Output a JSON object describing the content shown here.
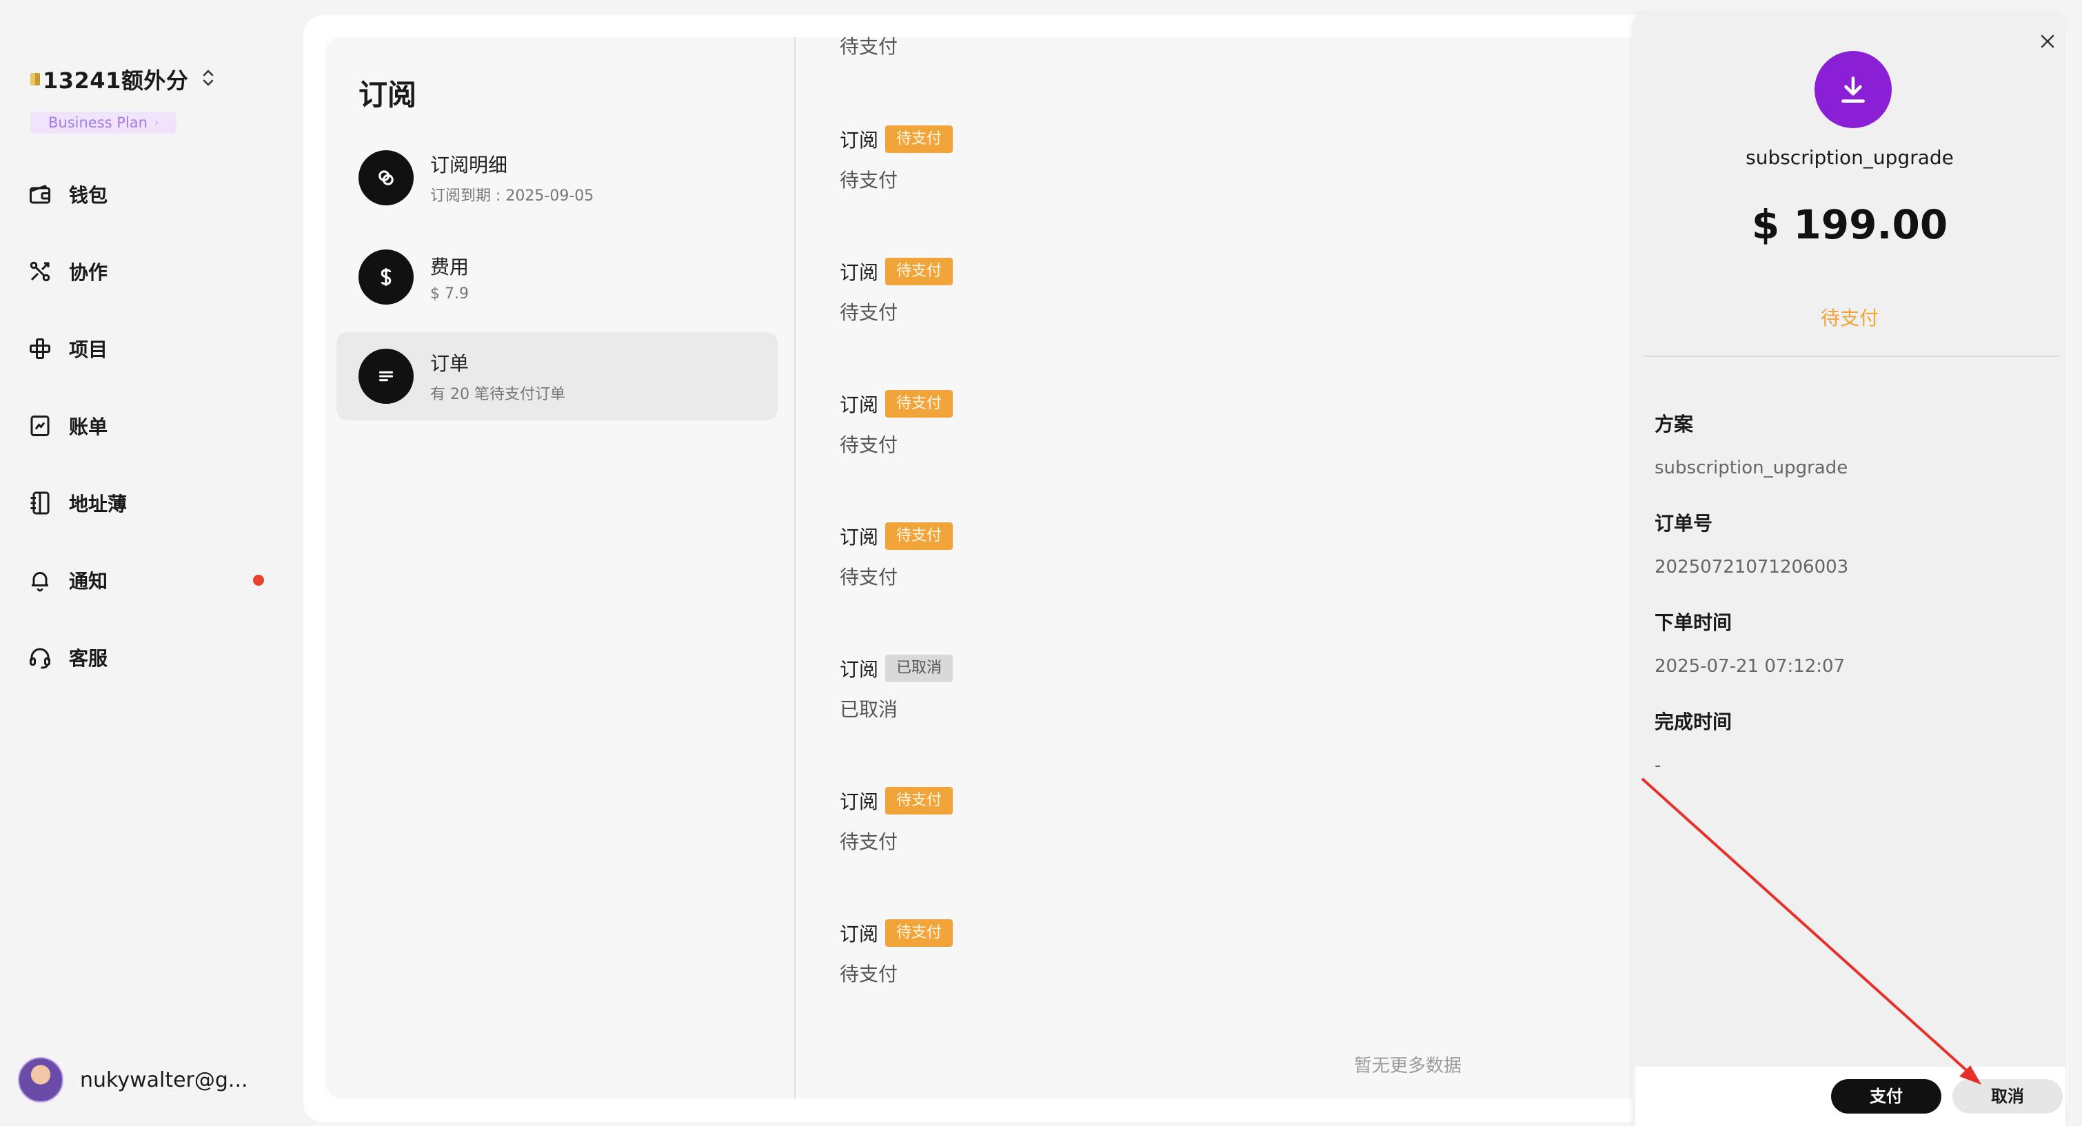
{
  "workspace": {
    "name": "13241额外分",
    "plan_badge": "Business Plan",
    "switch_icon": "chevron-up-down-icon"
  },
  "nav": [
    {
      "label": "钱包",
      "icon": "wallet-icon"
    },
    {
      "label": "协作",
      "icon": "collaborate-icon"
    },
    {
      "label": "项目",
      "icon": "project-icon"
    },
    {
      "label": "账单",
      "icon": "bill-icon"
    },
    {
      "label": "地址薄",
      "icon": "address-book-icon"
    },
    {
      "label": "通知",
      "icon": "bell-icon",
      "has_unread_dot": true
    },
    {
      "label": "客服",
      "icon": "headset-icon"
    }
  ],
  "user": {
    "email": "nukywalter@g..."
  },
  "subscription": {
    "title": "订阅",
    "menu": [
      {
        "title": "订阅明细",
        "subtitle": "订阅到期 : 2025-09-05",
        "icon": "link-icon"
      },
      {
        "title": "费用",
        "subtitle": "$ 7.9",
        "icon": "dollar-icon"
      },
      {
        "title": "订单",
        "subtitle": "有 20 笔待支付订单",
        "icon": "list-icon",
        "active": true
      }
    ]
  },
  "orders": {
    "top_partial_status": "待支付",
    "items": [
      {
        "title": "订阅",
        "tag": "待支付",
        "status": "待支付",
        "kind": "pending"
      },
      {
        "title": "订阅",
        "tag": "待支付",
        "status": "待支付",
        "kind": "pending"
      },
      {
        "title": "订阅",
        "tag": "待支付",
        "status": "待支付",
        "kind": "pending"
      },
      {
        "title": "订阅",
        "tag": "待支付",
        "status": "待支付",
        "kind": "pending"
      },
      {
        "title": "订阅",
        "tag": "已取消",
        "status": "已取消",
        "kind": "cancel"
      },
      {
        "title": "订阅",
        "tag": "待支付",
        "status": "待支付",
        "kind": "pending"
      },
      {
        "title": "订阅",
        "tag": "待支付",
        "status": "待支付",
        "kind": "pending"
      }
    ],
    "no_more": "暂无更多数据"
  },
  "drawer": {
    "plan_name": "subscription_upgrade",
    "amount": "$ 199.00",
    "status": "待支付",
    "fields": [
      {
        "label": "方案",
        "value": "subscription_upgrade"
      },
      {
        "label": "订单号",
        "value": "20250721071206003"
      },
      {
        "label": "下单时间",
        "value": "2025-07-21 07:12:07"
      },
      {
        "label": "完成时间",
        "value": "-"
      }
    ],
    "pay_label": "支付",
    "cancel_label": "取消"
  },
  "colors": {
    "accent_purple": "#8a1fd6",
    "pending_orange": "#f0a43a",
    "annotation_red": "#e8302a"
  }
}
